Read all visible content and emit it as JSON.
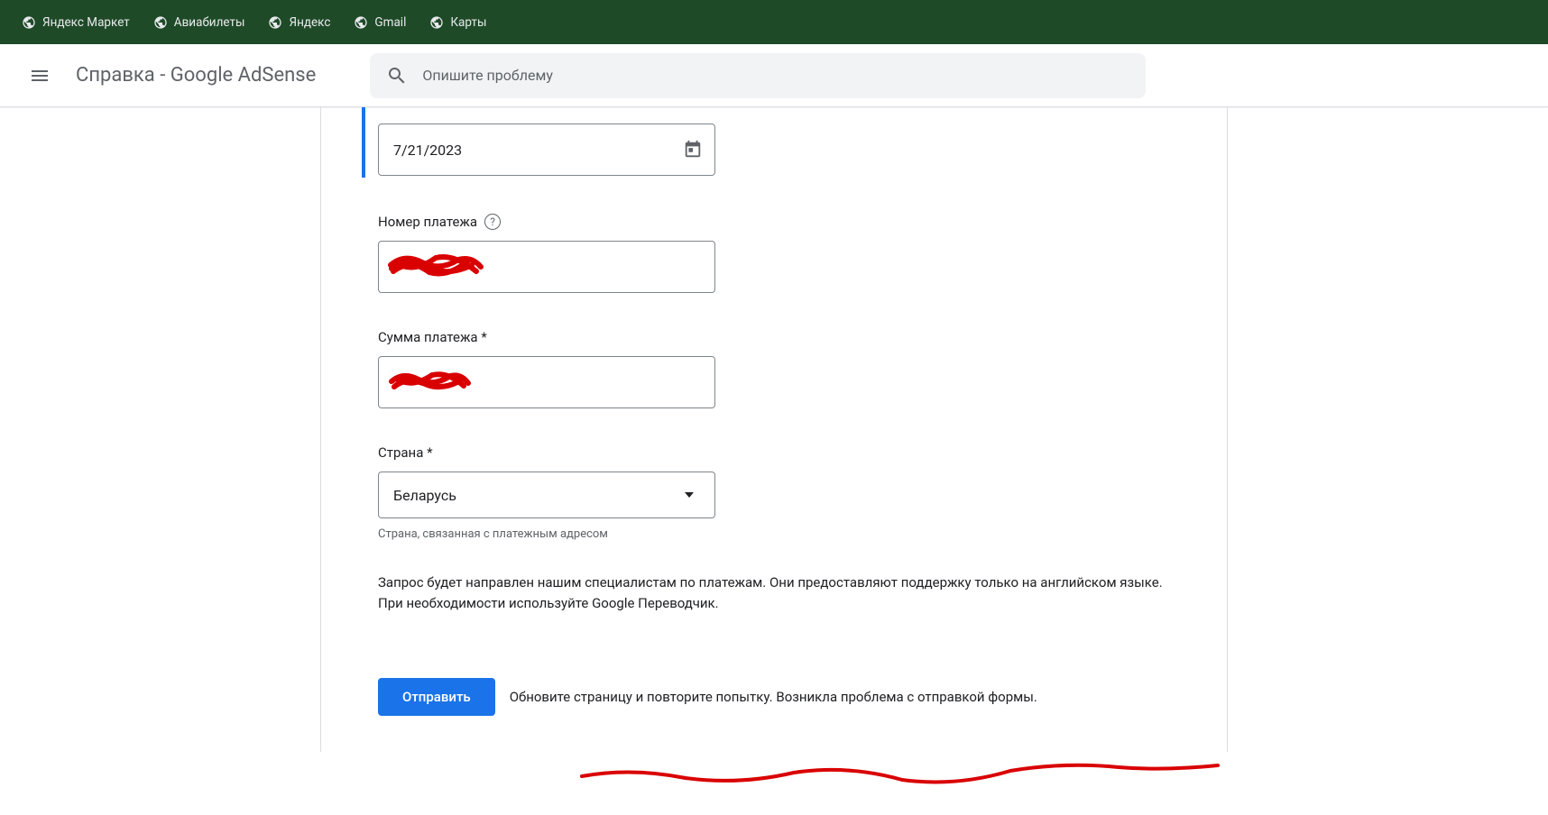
{
  "bookmarks": [
    {
      "label": "Яндекс Маркет"
    },
    {
      "label": "Авиабилеты"
    },
    {
      "label": "Яндекс"
    },
    {
      "label": "Gmail"
    },
    {
      "label": "Карты"
    }
  ],
  "header": {
    "title": "Справка - Google AdSense",
    "search_placeholder": "Опишите проблему"
  },
  "form": {
    "date_value": "7/21/2023",
    "payment_number_label": "Номер платежа",
    "payment_number_value": "",
    "payment_amount_label": "Сумма платежа *",
    "payment_amount_value": "",
    "country_label": "Страна *",
    "country_value": "Беларусь",
    "country_hint": "Страна, связанная с платежным адресом",
    "info_text": "Запрос будет направлен нашим специалистам по платежам. Они предоставляют поддержку только на английском языке. При необходимости используйте Google Переводчик.",
    "submit_label": "Отправить",
    "error_message": "Обновите страницу и повторите попытку. Возникла проблема с отправкой формы."
  }
}
